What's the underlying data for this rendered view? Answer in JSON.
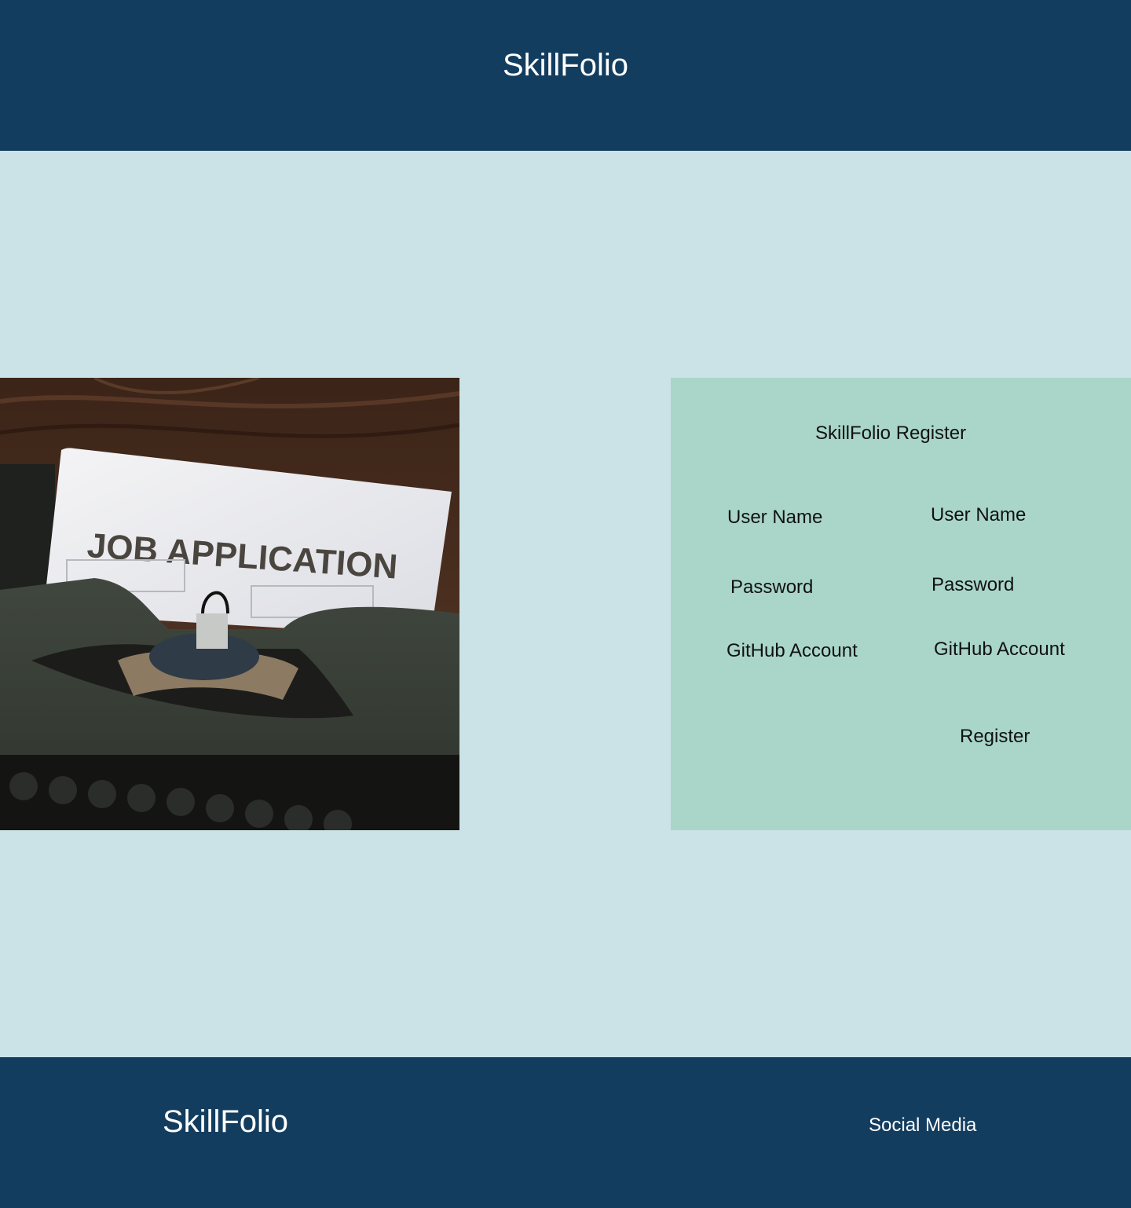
{
  "header": {
    "title": "SkillFolio"
  },
  "hero": {
    "image_label": "JOB APPLICATION"
  },
  "register": {
    "title": "SkillFolio Register",
    "labels": {
      "user_name": "User Name",
      "password": "Password",
      "github": "GitHub Account"
    },
    "inputs": {
      "user_name": "User Name",
      "password": "Password",
      "github": "GitHub Account"
    },
    "button_label": "Register"
  },
  "footer": {
    "brand": "SkillFolio",
    "social": "Social Media"
  },
  "colors": {
    "header_bg": "#133d5f",
    "page_bg": "#cbe3e7",
    "panel_bg": "#a9d6c8"
  }
}
